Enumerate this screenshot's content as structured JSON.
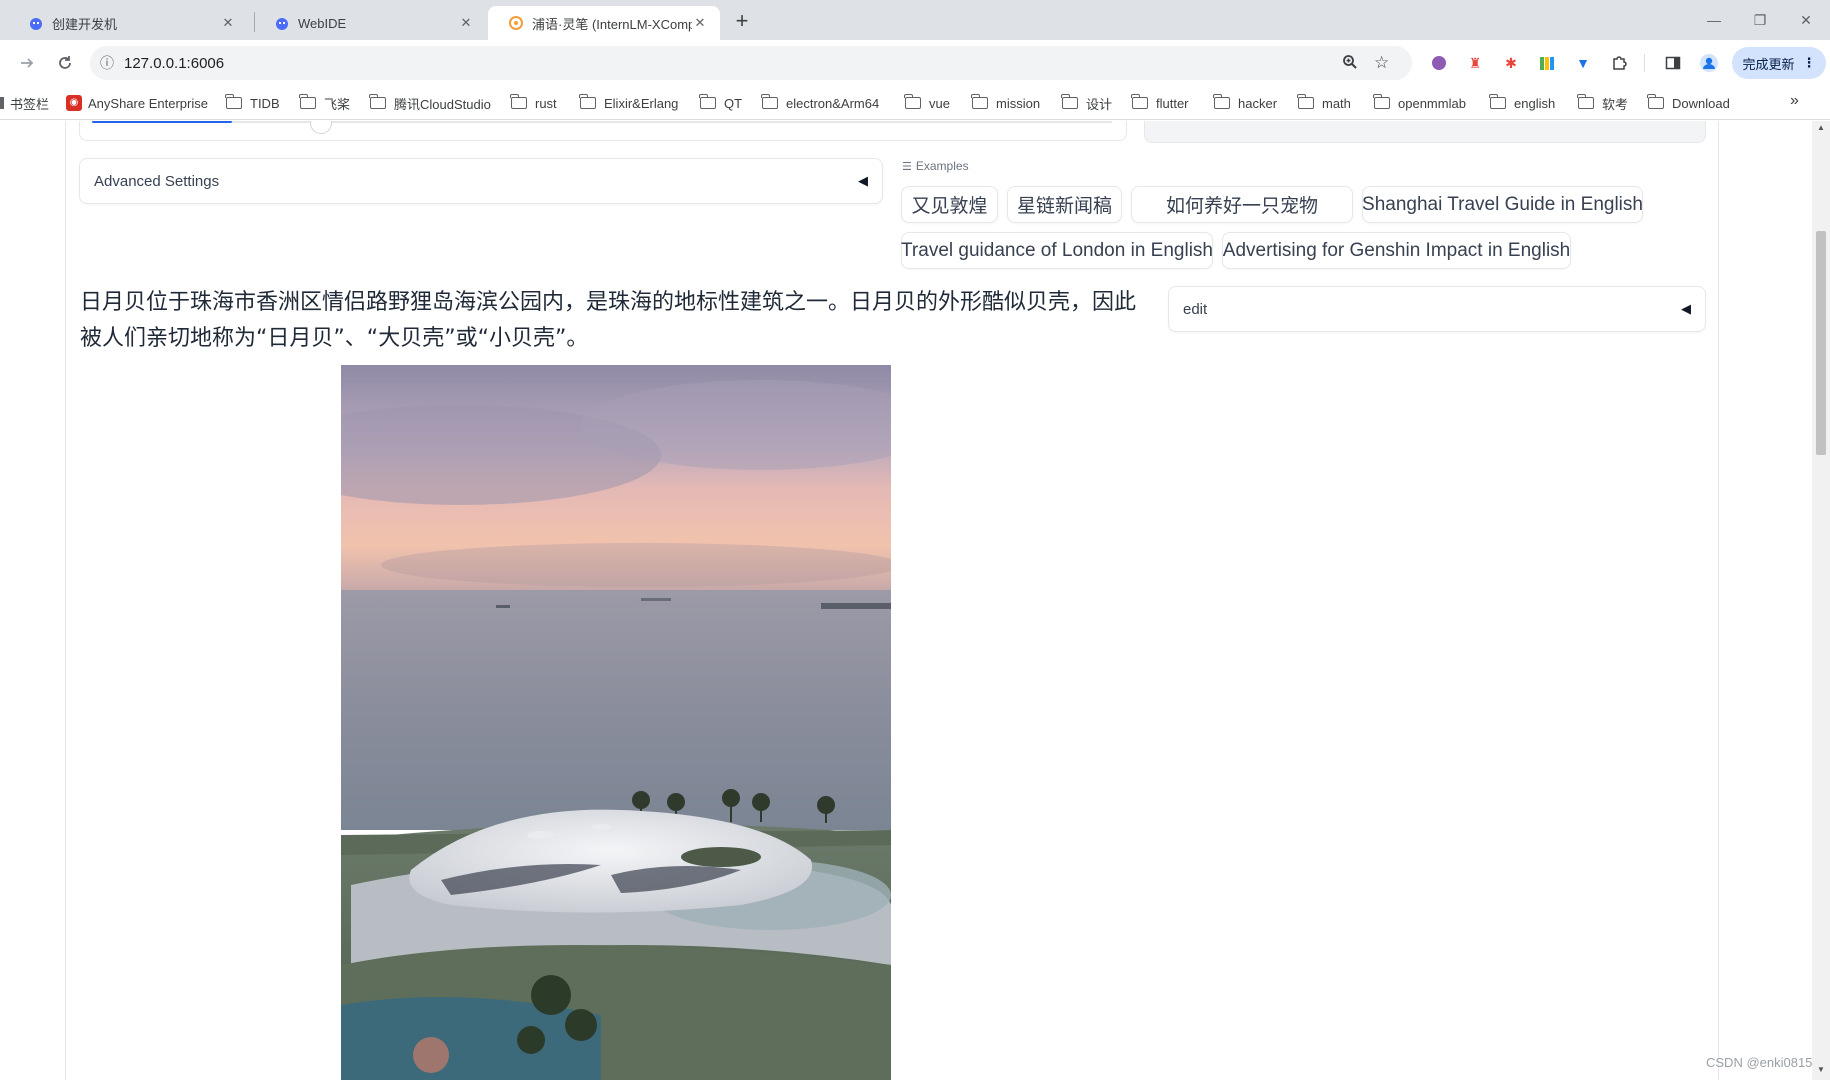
{
  "browser": {
    "tabs": [
      {
        "title": "创建开发机",
        "active": false
      },
      {
        "title": "WebIDE",
        "active": false
      },
      {
        "title": "浦语·灵笔 (InternLM-XCompo",
        "active": true
      }
    ],
    "close_glyph": "✕",
    "new_tab_glyph": "+",
    "window_controls": {
      "minimize": "—",
      "restore": "❐",
      "close": "✕"
    },
    "address_bar": {
      "url": "127.0.0.1:6006",
      "info_glyph": "ⓘ"
    },
    "update_button": {
      "label": "完成更新",
      "menu_glyph": "⋮"
    }
  },
  "bookmarks": {
    "items": [
      {
        "label": "书签栏",
        "icon": "partial"
      },
      {
        "label": "AnyShare Enterprise",
        "icon": "anyshare-icon"
      },
      {
        "label": "TIDB",
        "icon": "folder-icon"
      },
      {
        "label": "飞桨",
        "icon": "folder-icon"
      },
      {
        "label": "腾讯CloudStudio",
        "icon": "folder-icon"
      },
      {
        "label": "rust",
        "icon": "folder-icon"
      },
      {
        "label": "Elixir&Erlang",
        "icon": "folder-icon"
      },
      {
        "label": "QT",
        "icon": "folder-icon"
      },
      {
        "label": "electron&Arm64",
        "icon": "folder-icon"
      },
      {
        "label": "vue",
        "icon": "folder-icon"
      },
      {
        "label": "mission",
        "icon": "folder-icon"
      },
      {
        "label": "设计",
        "icon": "folder-icon"
      },
      {
        "label": "flutter",
        "icon": "folder-icon"
      },
      {
        "label": "hacker",
        "icon": "folder-icon"
      },
      {
        "label": "math",
        "icon": "folder-icon"
      },
      {
        "label": "openmmlab",
        "icon": "folder-icon"
      },
      {
        "label": "english",
        "icon": "folder-icon"
      },
      {
        "label": "软考",
        "icon": "folder-icon"
      },
      {
        "label": "Download",
        "icon": "folder-icon"
      }
    ],
    "more_glyph": "»"
  },
  "app": {
    "advanced_settings": {
      "label": "Advanced Settings",
      "arrow": "◀"
    },
    "examples": {
      "label": "Examples",
      "items": [
        "又见敦煌",
        "星链新闻稿",
        "如何养好一只宠物",
        "Shanghai Travel Guide in English",
        "Travel guidance of London in English",
        "Advertising for Genshin Impact in English"
      ]
    },
    "output_text": "日月贝位于珠海市香洲区情侣路野狸岛海滨公园内，是珠海的地标性建筑之一。日月贝的外形酷似贝壳，因此被人们亲切地称为“日月贝”、“大贝壳”或“小贝壳”。",
    "edit_accordion": {
      "label": "edit",
      "arrow": "◀"
    }
  },
  "watermark": "CSDN @enki0815"
}
